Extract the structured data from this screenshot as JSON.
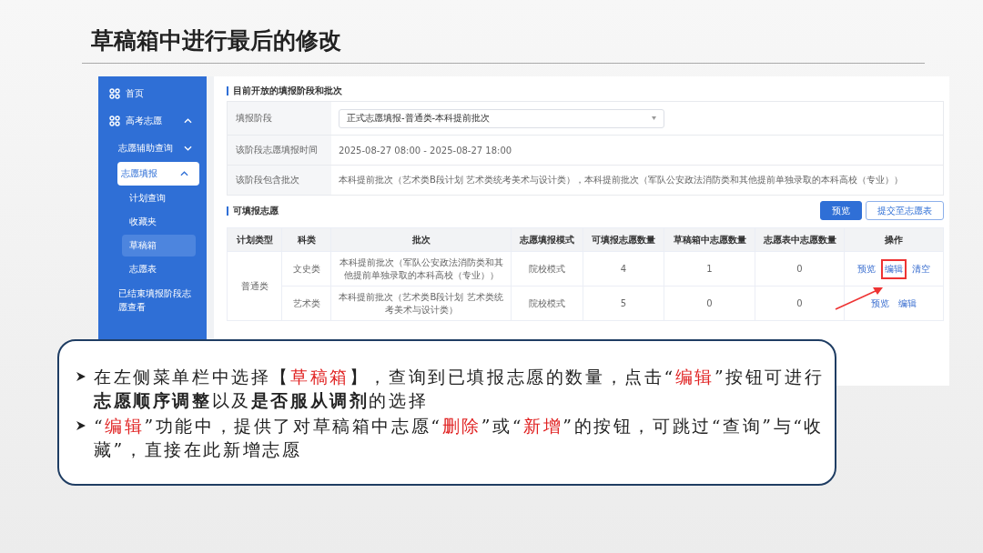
{
  "slide_title": "草稿箱中进行最后的修改",
  "sidebar": {
    "items": [
      {
        "label": "首页",
        "kind": "top",
        "selected": false
      },
      {
        "label": "高考志愿",
        "kind": "top",
        "expanded": true,
        "selected": false,
        "children": [
          {
            "label": "志愿辅助查询",
            "expanded": false,
            "active": false,
            "selected": false
          },
          {
            "label": "志愿填报",
            "expanded": true,
            "active": true,
            "selected": false,
            "children": [
              {
                "label": "计划查询",
                "selected": false
              },
              {
                "label": "收藏夹",
                "selected": false
              },
              {
                "label": "草稿箱",
                "selected": true
              },
              {
                "label": "志愿表",
                "selected": false
              }
            ]
          },
          {
            "label": "已结束填报阶段志愿查看",
            "active": false,
            "selected": false
          }
        ]
      }
    ]
  },
  "stage_section": {
    "heading": "目前开放的填报阶段和批次",
    "rows": [
      {
        "label": "填报阶段",
        "kind": "select",
        "value": "正式志愿填报-普通类-本科提前批次"
      },
      {
        "label": "该阶段志愿填报时间",
        "kind": "text",
        "value": "2025-08-27 08:00 - 2025-08-27 18:00"
      },
      {
        "label": "该阶段包含批次",
        "kind": "text",
        "value": "本科提前批次（艺术类B段计划 艺术类统考美术与设计类），本科提前批次（军队公安政法消防类和其他提前单独录取的本科高校（专业））"
      }
    ]
  },
  "choices_section": {
    "heading": "可填报志愿",
    "buttons": [
      {
        "label": "预览",
        "kind": "primary"
      },
      {
        "label": "提交至志愿表",
        "kind": "outline"
      }
    ],
    "table": {
      "columns": [
        "计划类型",
        "科类",
        "批次",
        "志愿填报模式",
        "可填报志愿数量",
        "草稿箱中志愿数量",
        "志愿表中志愿数量",
        "操作"
      ],
      "groups": [
        {
          "plan_type": "普通类",
          "rows": [
            {
              "subject": "文史类",
              "batch": "本科提前批次（军队公安政法消防类和其他提前单独录取的本科高校（专业））",
              "mode": "院校模式",
              "available": "4",
              "in_draft": "1",
              "in_list": "0",
              "actions": [
                {
                  "label": "预览",
                  "highlighted": false
                },
                {
                  "label": "编辑",
                  "highlighted": true
                },
                {
                  "label": "清空",
                  "highlighted": false
                }
              ]
            },
            {
              "subject": "艺术类",
              "batch": "本科提前批次（艺术类B段计划 艺术类统考美术与设计类）",
              "mode": "院校模式",
              "available": "5",
              "in_draft": "0",
              "in_list": "0",
              "actions": [
                {
                  "label": "预览",
                  "highlighted": false
                },
                {
                  "label": "编辑",
                  "highlighted": false
                }
              ]
            }
          ]
        }
      ]
    }
  },
  "callout": {
    "bullets": [
      [
        {
          "text": "在左侧菜单栏中选择【",
          "kind": "normal"
        },
        {
          "text": "草稿箱",
          "kind": "highlight"
        },
        {
          "text": "】，查询到已填报志愿的数量，点击“",
          "kind": "normal"
        },
        {
          "text": "编辑",
          "kind": "highlight"
        },
        {
          "text": "”按钮可进行**志愿顺序调整**以及**是否服从调剂**的选择",
          "kind": "normal"
        }
      ],
      [
        {
          "text": "“",
          "kind": "normal"
        },
        {
          "text": "编辑",
          "kind": "highlight"
        },
        {
          "text": "”功能中，提供了对草稿箱中志愿“",
          "kind": "normal"
        },
        {
          "text": "删除",
          "kind": "highlight"
        },
        {
          "text": "”或“",
          "kind": "normal"
        },
        {
          "text": "新增",
          "kind": "highlight"
        },
        {
          "text": "”的按钮，可跳过“查询”与“收藏”，直接在此新增志愿",
          "kind": "normal"
        }
      ]
    ]
  }
}
